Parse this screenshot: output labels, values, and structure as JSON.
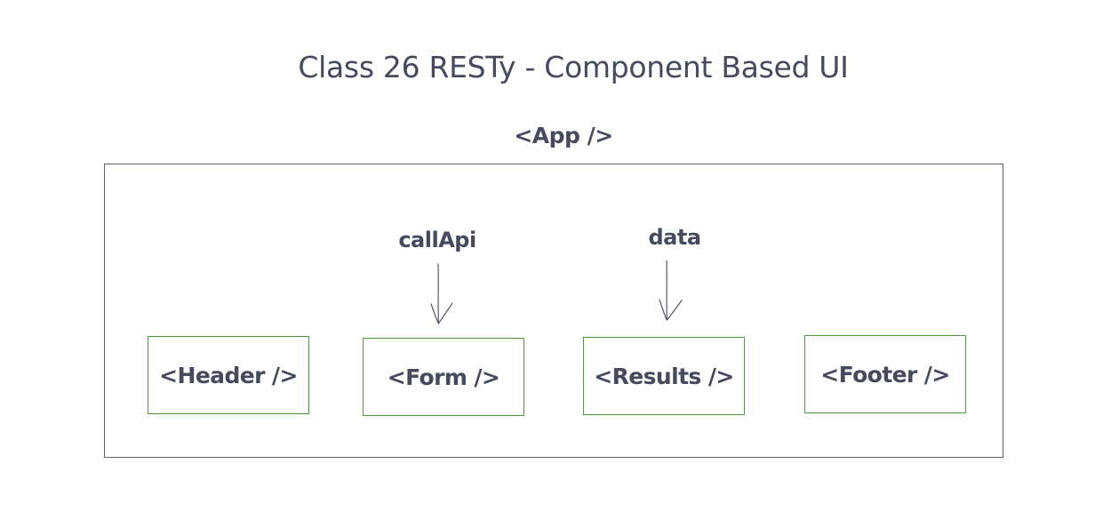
{
  "title": "Class 26 RESTy - Component Based UI",
  "app": {
    "label": "<App />"
  },
  "props": {
    "call_api": "callApi",
    "data": "data"
  },
  "components": [
    {
      "label": "<Header />"
    },
    {
      "label": "<Form />"
    },
    {
      "label": "<Results />"
    },
    {
      "label": "<Footer />"
    }
  ],
  "colors": {
    "text": "#454b5c",
    "component_border": "#4a9a3c",
    "app_border": "#5d616b"
  }
}
